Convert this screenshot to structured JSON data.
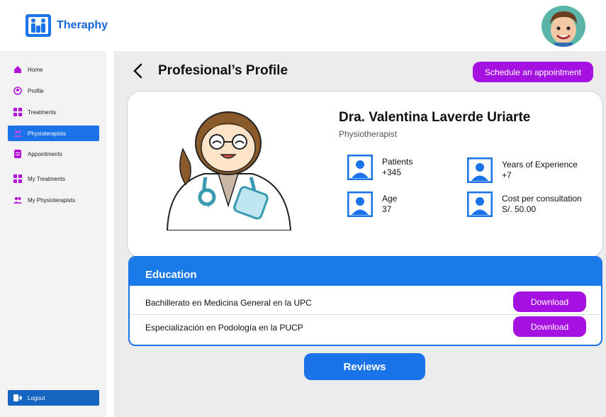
{
  "app": {
    "name": "Theraphy"
  },
  "sidebar": {
    "items": [
      {
        "label": "Home",
        "icon": "home-icon"
      },
      {
        "label": "Profile",
        "icon": "profile-icon"
      },
      {
        "label": "Treatments",
        "icon": "grid-icon"
      },
      {
        "label": "Physioterapists",
        "icon": "group-icon"
      },
      {
        "label": "Appointments",
        "icon": "document-icon"
      },
      {
        "label": "My Treatments",
        "icon": "grid-icon"
      },
      {
        "label": "My Physioterapists",
        "icon": "group-icon"
      }
    ],
    "active_index": 3,
    "logout_label": "Logout"
  },
  "header": {
    "title": "Profesional’s Profile",
    "schedule_label": "Schedule an appointment"
  },
  "profile": {
    "name": "Dra. Valentina Laverde Uriarte",
    "role": "Physiotherapist",
    "stats": [
      {
        "label": "Patients",
        "value": "+345"
      },
      {
        "label": "Years of Experience",
        "value": "+7"
      },
      {
        "label": "Age",
        "value": "37"
      },
      {
        "label": "Cost per consultation",
        "value": "S/. 50.00"
      }
    ]
  },
  "education": {
    "title": "Education",
    "items": [
      {
        "label": "Bachillerato en Medicina General en la UPC",
        "button": "Download"
      },
      {
        "label": "Especialización en Podología en la PUCP",
        "button": "Download"
      }
    ]
  },
  "reviews_label": "Reviews",
  "colors": {
    "primary": "#1a73e8",
    "accent": "#a511e0",
    "sidebar_bg": "#f3f3f4",
    "main_bg": "#ececec"
  }
}
